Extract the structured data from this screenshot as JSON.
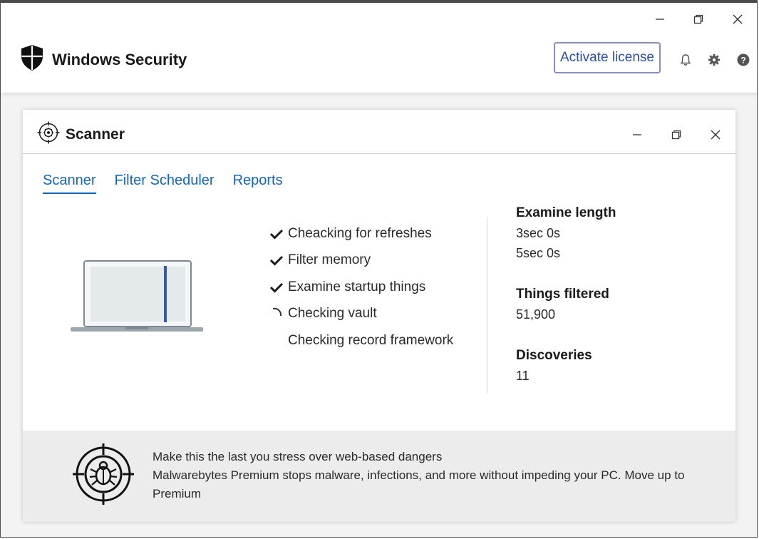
{
  "app": {
    "title": "Windows Security",
    "activate_label": "Activate license",
    "icons": [
      "shield-icon",
      "bell-icon",
      "gear-icon",
      "help-icon"
    ]
  },
  "window_controls": [
    "minimize-icon",
    "restore-icon",
    "close-icon"
  ],
  "panel": {
    "title": "Scanner",
    "icon": "scanner-crosshair-icon",
    "tabs": [
      {
        "label": "Scanner",
        "active": true
      },
      {
        "label": "Filter Scheduler",
        "active": false
      },
      {
        "label": "Reports",
        "active": false
      }
    ],
    "steps": [
      {
        "label": "Cheacking for refreshes",
        "status": "done"
      },
      {
        "label": "Filter memory",
        "status": "done"
      },
      {
        "label": "Examine startup things",
        "status": "done"
      },
      {
        "label": "Checking vault",
        "status": "in-progress"
      },
      {
        "label": "Checking record framework",
        "status": "pending"
      }
    ],
    "stats": {
      "examine_length_label": "Examine length",
      "examine_length_value_1": "3sec 0s",
      "examine_length_value_2": "5sec 0s",
      "things_filtered_label": "Things filtered",
      "things_filtered_value": "51,900",
      "discoveries_label": "Discoveries",
      "discoveries_value": "11"
    },
    "promo": {
      "icon": "bug-target-icon",
      "line1": "Make this the last you stress over web-based dangers",
      "line2": "Malwarebytes Premium stops malware, infections, and more without impeding your PC. Move up to Premium"
    }
  },
  "colors": {
    "accent": "#1565c0",
    "activate_border": "#8a8fb8",
    "promo_bg": "#ececec"
  }
}
